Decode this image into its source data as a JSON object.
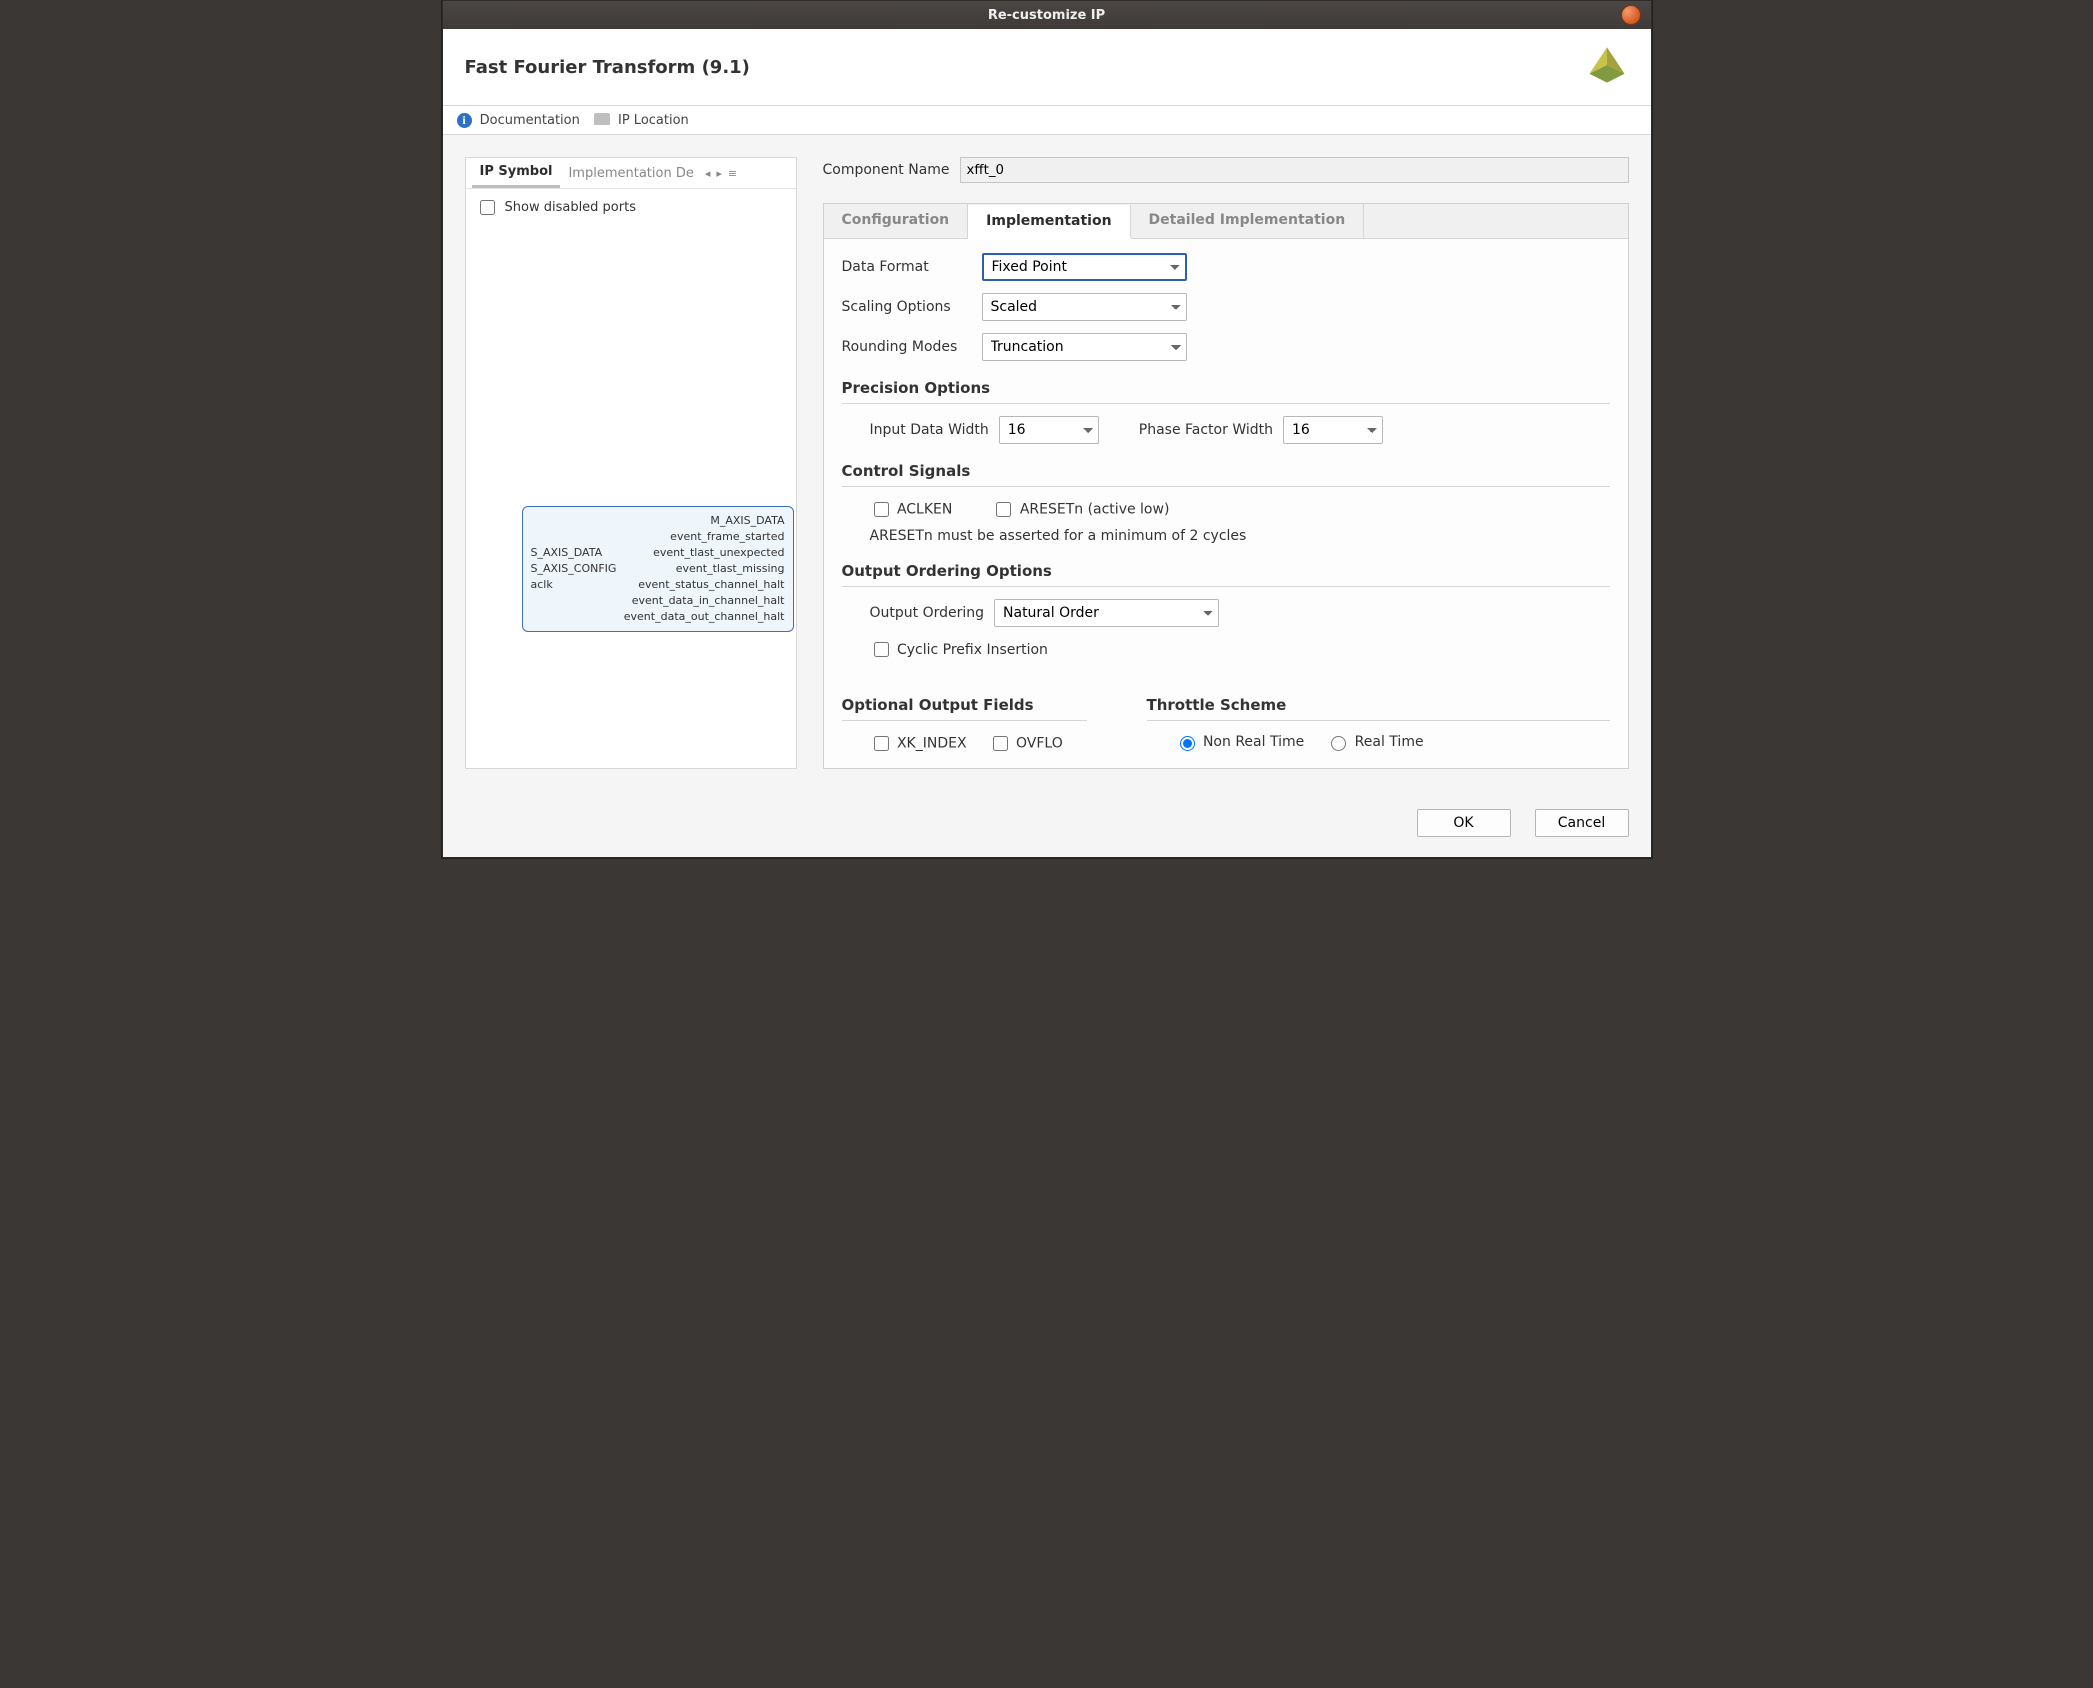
{
  "window": {
    "title": "Re-customize IP"
  },
  "header": {
    "ip_name": "Fast Fourier Transform (9.1)"
  },
  "toolbar": {
    "docs": "Documentation",
    "iploc": "IP Location"
  },
  "left": {
    "tabs": {
      "ipsymbol": "IP Symbol",
      "impldetails": "Implementation De"
    },
    "show_disabled": "Show disabled ports"
  },
  "ip_block": {
    "left_ports": [
      "S_AXIS_DATA",
      "S_AXIS_CONFIG",
      "aclk"
    ],
    "right_ports": [
      "M_AXIS_DATA",
      "event_frame_started",
      "event_tlast_unexpected",
      "event_tlast_missing",
      "event_status_channel_halt",
      "event_data_in_channel_halt",
      "event_data_out_channel_halt"
    ]
  },
  "component": {
    "label": "Component Name",
    "value": "xfft_0"
  },
  "cfg_tabs": {
    "configuration": "Configuration",
    "implementation": "Implementation",
    "detailed": "Detailed Implementation"
  },
  "impl": {
    "data_format": {
      "label": "Data Format",
      "value": "Fixed Point"
    },
    "scaling": {
      "label": "Scaling Options",
      "value": "Scaled"
    },
    "rounding": {
      "label": "Rounding Modes",
      "value": "Truncation"
    },
    "precision": {
      "title": "Precision Options",
      "input_width": {
        "label": "Input Data Width",
        "value": "16"
      },
      "phase_width": {
        "label": "Phase Factor Width",
        "value": "16"
      }
    },
    "control": {
      "title": "Control Signals",
      "aclken": "ACLKEN",
      "aresetn": "ARESETn (active low)",
      "note": "ARESETn must be asserted for a minimum of 2 cycles"
    },
    "ordering": {
      "title": "Output Ordering Options",
      "label": "Output Ordering",
      "value": "Natural Order",
      "cyclic": "Cyclic Prefix Insertion"
    },
    "optional": {
      "title": "Optional Output Fields",
      "xk_index": "XK_INDEX",
      "ovflo": "OVFLO"
    },
    "throttle": {
      "title": "Throttle Scheme",
      "non_rt": "Non Real Time",
      "rt": "Real Time"
    }
  },
  "buttons": {
    "ok": "OK",
    "cancel": "Cancel"
  }
}
